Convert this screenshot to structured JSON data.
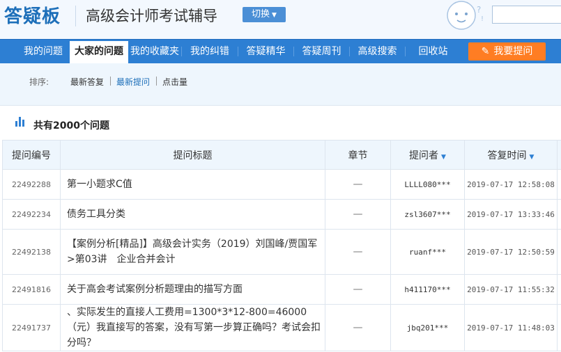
{
  "header": {
    "logo": "答疑板",
    "title": "高级会计师考试辅导",
    "switch_label": "切换",
    "search_placeholder": ""
  },
  "nav": {
    "items": [
      {
        "label": "我的问题"
      },
      {
        "label": "大家的问题",
        "active": true
      },
      {
        "label": "我的收藏夹"
      },
      {
        "label": "我的纠错"
      },
      {
        "label": "答疑精华"
      },
      {
        "label": "答疑周刊"
      },
      {
        "label": "高级搜索"
      },
      {
        "label": "回收站"
      }
    ],
    "ask_label": "我要提问"
  },
  "sort": {
    "label": "排序:",
    "options": [
      {
        "label": "最新答复"
      },
      {
        "label": "最新提问",
        "active": true
      },
      {
        "label": "点击量"
      }
    ]
  },
  "summary": {
    "count_text": "共有2000个问题"
  },
  "table": {
    "headers": {
      "id": "提问编号",
      "title": "提问标题",
      "chapter": "章节",
      "asker": "提问者",
      "time": "答复时间"
    },
    "rows": [
      {
        "id": "22492288",
        "title": "第一小题求C值",
        "chapter": "—",
        "asker": "LLLL080***",
        "time": "2019-07-17 12:58:08"
      },
      {
        "id": "22492234",
        "title": "债务工具分类",
        "chapter": "—",
        "asker": "zsl3607***",
        "time": "2019-07-17 13:33:46"
      },
      {
        "id": "22492138",
        "title": "【案例分析[精品]】高级会计实务（2019）刘国峰/贾国军>第03讲　企业合并会计",
        "chapter": "—",
        "asker": "ruanf***",
        "time": "2019-07-17 12:50:59"
      },
      {
        "id": "22491816",
        "title": "关于高会考试案例分析题理由的描写方面",
        "chapter": "—",
        "asker": "h411170***",
        "time": "2019-07-17 11:55:32"
      },
      {
        "id": "22491737",
        "title": "、实际发生的直接人工费用=1300*3*12-800=46000（元）我直接写的答案，没有写第一步算正确吗？考试会扣分吗？",
        "chapter": "—",
        "asker": "jbq201***",
        "time": "2019-07-17 11:48:03"
      }
    ]
  },
  "colors": {
    "nav_blue": "#2d7fd3",
    "ask_orange": "#ff7d23",
    "link_blue": "#1d6fb9"
  }
}
